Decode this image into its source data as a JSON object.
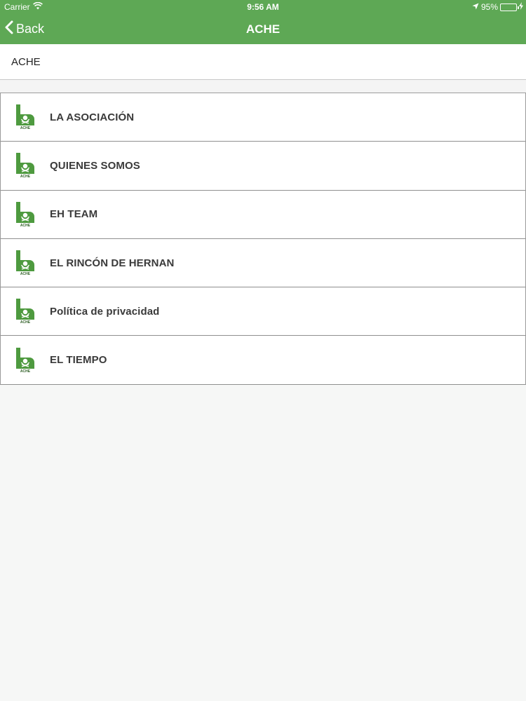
{
  "status_bar": {
    "carrier": "Carrier",
    "time": "9:56 AM",
    "battery": "95%",
    "battery_level": 0.95,
    "icons": [
      "wifi-icon",
      "location-arrow-icon",
      "battery-icon",
      "charging-bolt-icon"
    ]
  },
  "nav": {
    "back_label": "Back",
    "title": "ACHE"
  },
  "section": {
    "header": "ACHE"
  },
  "menu": {
    "icon": "ache-logo-icon",
    "items": [
      {
        "label": "LA ASOCIACIÓN"
      },
      {
        "label": "QUIENES SOMOS"
      },
      {
        "label": "EH TEAM"
      },
      {
        "label": "EL RINCÓN DE HERNAN"
      },
      {
        "label": "Política de privacidad"
      },
      {
        "label": "EL TIEMPO"
      }
    ]
  },
  "logo": {
    "text": "ACHE"
  },
  "colors": {
    "brand_green": "#5ea855",
    "icon_green": "#4e9a3f",
    "background": "#f6f7f6"
  }
}
